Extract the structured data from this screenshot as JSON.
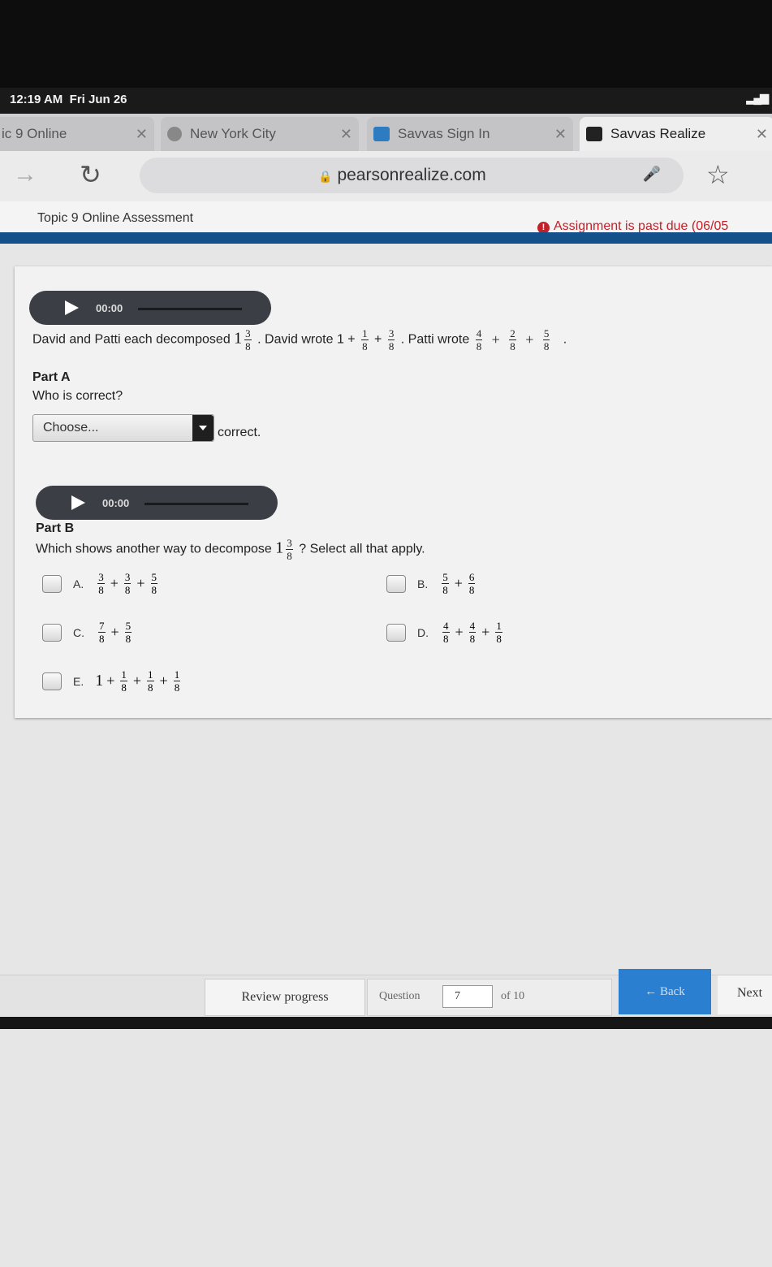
{
  "status_bar": {
    "time": "12:19 AM",
    "date": "Fri Jun 26"
  },
  "tabs": [
    {
      "label": "ic 9 Online",
      "icon": "tab-page-icon",
      "active": false
    },
    {
      "label": "New York City",
      "icon": "globe-icon",
      "active": false
    },
    {
      "label": "Savvas Sign In",
      "icon": "savvas-icon",
      "active": false
    },
    {
      "label": "Savvas Realize",
      "icon": "realize-icon",
      "active": true
    }
  ],
  "toolbar": {
    "url": "pearsonrealize.com"
  },
  "header": {
    "title": "Topic 9 Online Assessment",
    "alert": "Assignment is past due (06/05"
  },
  "audio": [
    {
      "time": "00:00"
    },
    {
      "time": "00:00"
    }
  ],
  "question": {
    "prompt_start": "David and Patti each decomposed",
    "prompt_david": ". David wrote 1 +",
    "prompt_patti": ". Patti wrote",
    "whole": "1",
    "frac_num": "3",
    "frac_den": "8",
    "david_nums": [
      "1",
      "3"
    ],
    "patti_nums": [
      "4",
      "2",
      "5"
    ],
    "den": "8",
    "plus": "+",
    "period": "."
  },
  "part_a": {
    "label": "Part A",
    "question": "Who is correct?",
    "select_value": "Choose...",
    "suffix": "correct."
  },
  "part_b": {
    "label": "Part B",
    "question_start": "Which shows another way to decompose",
    "question_end": "? Select all that apply.",
    "options": [
      {
        "letter": "A.",
        "whole": "",
        "nums": [
          "3",
          "3",
          "5"
        ]
      },
      {
        "letter": "B.",
        "whole": "",
        "nums": [
          "5",
          "6"
        ]
      },
      {
        "letter": "C.",
        "whole": "",
        "nums": [
          "7",
          "5"
        ]
      },
      {
        "letter": "D.",
        "whole": "",
        "nums": [
          "4",
          "4",
          "1"
        ]
      },
      {
        "letter": "E.",
        "whole": "1",
        "nums": [
          "1",
          "1",
          "1"
        ]
      }
    ]
  },
  "footer": {
    "review_label": "Review progress",
    "question_label": "Question",
    "question_value": "7",
    "question_total": "of 10",
    "back_label": "← Back",
    "next_label": "Next"
  }
}
